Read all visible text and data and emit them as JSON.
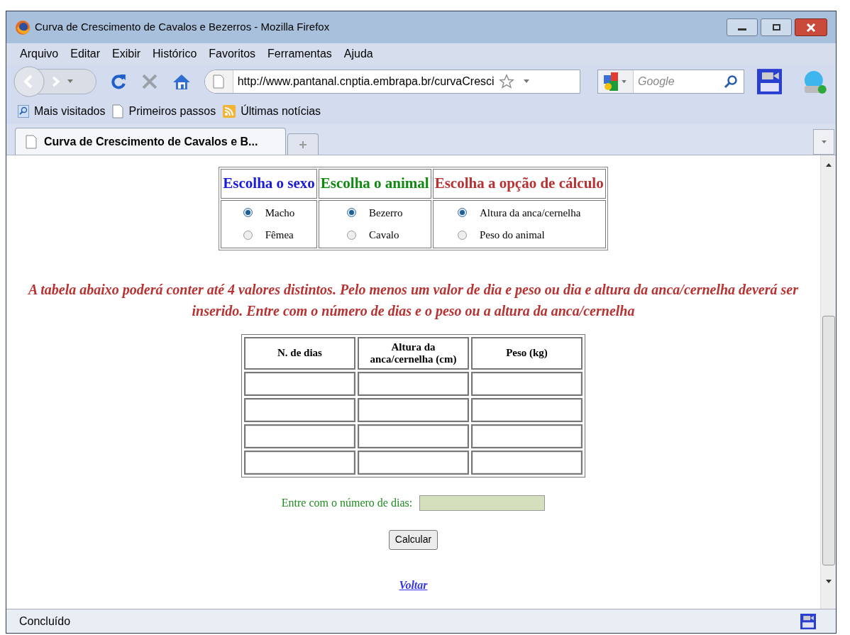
{
  "window": {
    "title": "Curva de Crescimento de Cavalos e Bezerros - Mozilla Firefox"
  },
  "menu": [
    "Arquivo",
    "Editar",
    "Exibir",
    "Histórico",
    "Favoritos",
    "Ferramentas",
    "Ajuda"
  ],
  "toolbar": {
    "url": "http://www.pantanal.cnptia.embrapa.br/curvaCresci",
    "search_placeholder": "Google"
  },
  "bookmarks": [
    {
      "label": "Mais visitados",
      "kind": "search"
    },
    {
      "label": "Primeiros passos",
      "kind": "page"
    },
    {
      "label": "Últimas notícias",
      "kind": "feed"
    }
  ],
  "tabs": [
    {
      "label": "Curva de Crescimento de Cavalos e B...",
      "selected": true
    }
  ],
  "choices": [
    {
      "heading": "Escolha o sexo",
      "color": "#1a1adb",
      "options": [
        {
          "label": "Macho",
          "selected": true
        },
        {
          "label": "Fêmea",
          "selected": false
        }
      ]
    },
    {
      "heading": "Escolha o animal",
      "color": "#118a11",
      "options": [
        {
          "label": "Bezerro",
          "selected": true
        },
        {
          "label": "Cavalo",
          "selected": false
        }
      ]
    },
    {
      "heading": "Escolha a opção de cálculo",
      "color": "#b83232",
      "options": [
        {
          "label": "Altura da anca/cernelha",
          "selected": true
        },
        {
          "label": "Peso do animal",
          "selected": false
        }
      ]
    }
  ],
  "instruction": "A tabela abaixo poderá conter até 4 valores distintos. Pelo menos um valor de dia e peso ou dia e altura da anca/cernelha deverá ser inserido. Entre com o número de dias e o peso ou a altura da anca/cernelha",
  "data_table": {
    "columns": [
      "N. de dias",
      "Altura da anca/cernelha (cm)",
      "Peso (kg)"
    ],
    "rows": [
      {
        "kind": "entry"
      },
      {
        "kind": "entry"
      },
      {
        "kind": "entry"
      },
      {
        "kind": "entry"
      }
    ]
  },
  "days_field": {
    "label": "Entre com o número de dias:"
  },
  "button": "Calcular",
  "link": "Voltar",
  "status_bar": "Concluído"
}
